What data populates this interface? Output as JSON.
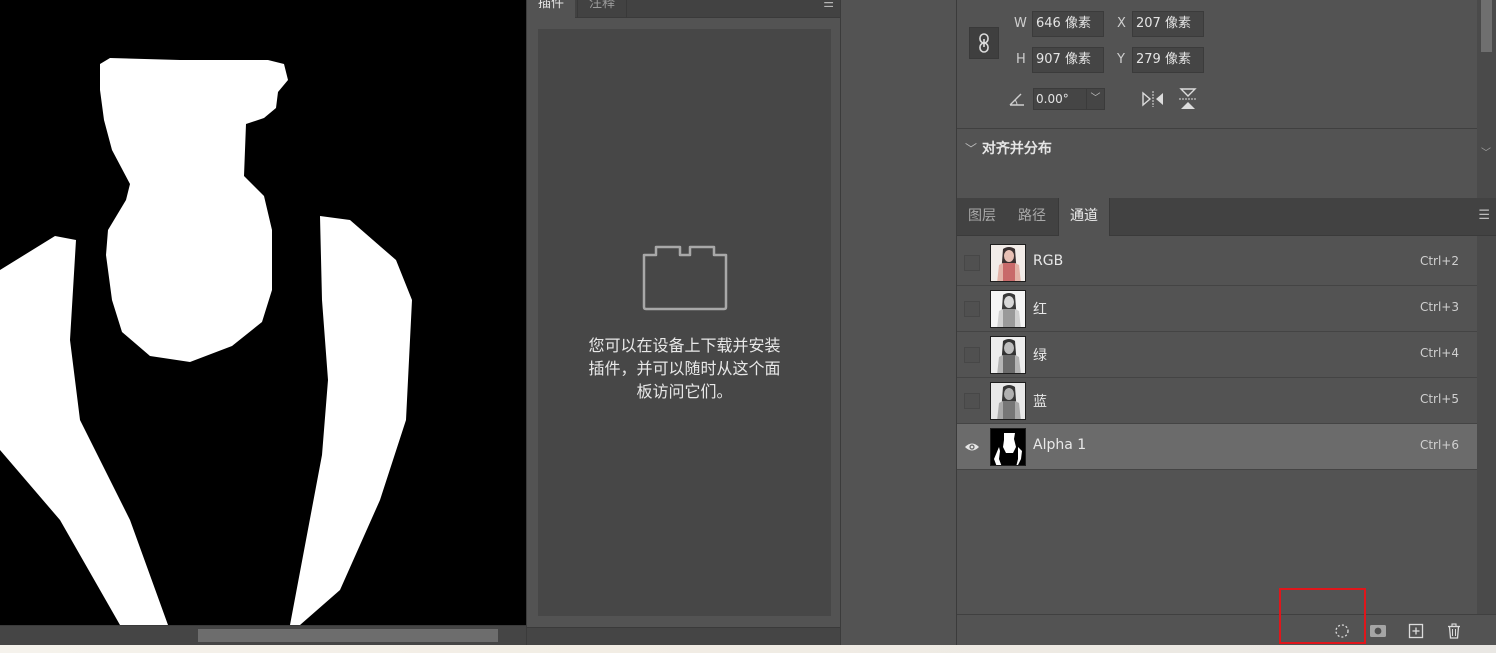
{
  "plugins_panel": {
    "tab_active": "插件",
    "tab_second": "注释",
    "menu_icon": "panel-menu-icon",
    "message_line1": "您可以在设备上下载并安装",
    "message_line2": "插件，并可以随时从这个面",
    "message_line3": "板访问它们。"
  },
  "properties": {
    "w_label": "W",
    "w_value": "646 像素",
    "h_label": "H",
    "h_value": "907 像素",
    "x_label": "X",
    "x_value": "207 像素",
    "y_label": "Y",
    "y_value": "279 像素",
    "angle_value": "0.00°",
    "section_title": "对齐并分布"
  },
  "channels_panel": {
    "tabs": [
      "图层",
      "路径",
      "通道"
    ],
    "active_tab": "通道",
    "rows": [
      {
        "name": "RGB",
        "shortcut": "Ctrl+2",
        "visible": false
      },
      {
        "name": "红",
        "shortcut": "Ctrl+3",
        "visible": false
      },
      {
        "name": "绿",
        "shortcut": "Ctrl+4",
        "visible": false
      },
      {
        "name": "蓝",
        "shortcut": "Ctrl+5",
        "visible": false
      },
      {
        "name": "Alpha 1",
        "shortcut": "Ctrl+6",
        "visible": true,
        "selected": true
      }
    ],
    "bottom_icons": [
      "load-selection-icon",
      "save-selection-icon",
      "new-channel-icon",
      "delete-channel-icon"
    ]
  },
  "colors": {
    "panel_bg": "#535353",
    "highlight_box": "#e0161b"
  }
}
